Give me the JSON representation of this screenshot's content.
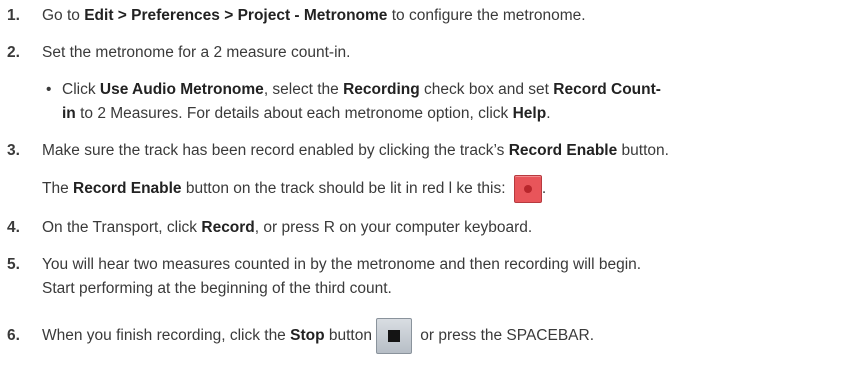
{
  "steps": [
    {
      "num": "1.",
      "pre": "Go to ",
      "bold": "Edit > Preferences > Project - Metronome",
      "post": " to configure the metronome."
    },
    {
      "num": "2.",
      "text": "Set the metronome for a 2 measure count-in."
    },
    {
      "num": "3.",
      "pre": "Make sure the track has been record enabled by clicking the track’s ",
      "bold": "Record Enable",
      "post": " button."
    },
    {
      "num": "4.",
      "pre": "On the Transport, click ",
      "bold": "Record",
      "post": ", or press R on your computer keyboard."
    },
    {
      "num": "5.",
      "line1": "You will hear two measures counted in by the metronome and then recording will begin.",
      "line2": "Start performing at the beginning of the third count."
    },
    {
      "num": "6.",
      "pre": "When you finish recording, click the ",
      "bold": "Stop",
      "mid": " button",
      "post": " or press the SPACEBAR."
    }
  ],
  "substep": {
    "bullet": "•",
    "a": "Click ",
    "b1": "Use Audio Metronome",
    "c": ", select the ",
    "b2": "Recording",
    "d": " check box and set ",
    "b3": "Record Count-",
    "e": "in",
    "f": " to 2 Measures. For details about each metronome option, click ",
    "b4": "Help",
    "g": "."
  },
  "note3": {
    "pre": "The ",
    "bold": "Record Enable",
    "post": " button on the track should be lit in red l ke this: ",
    "end": "."
  }
}
